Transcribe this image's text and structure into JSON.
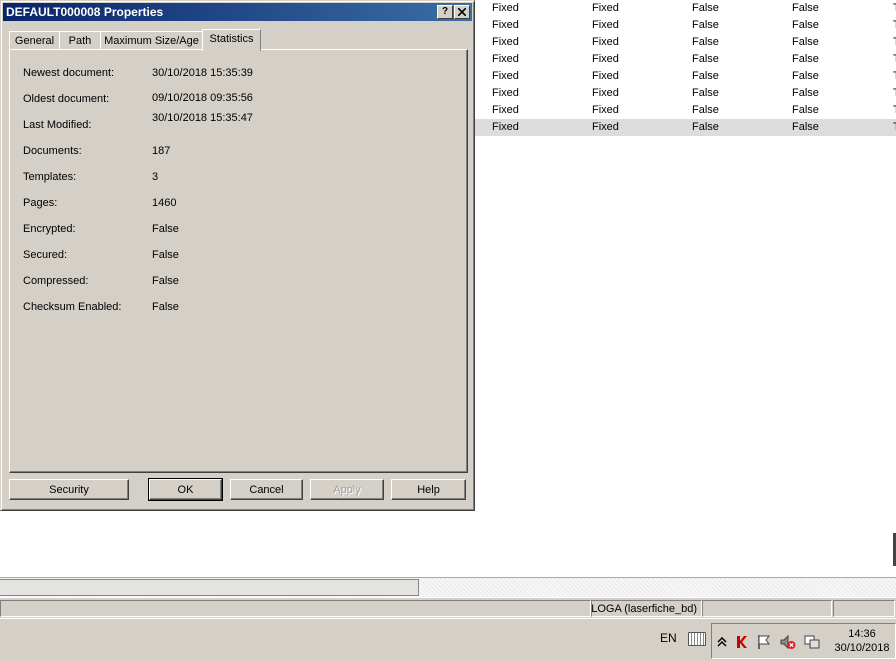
{
  "dialog": {
    "title": "DEFAULT000008 Properties",
    "help_btn": "?",
    "close_btn": "✕",
    "tabs": [
      "General",
      "Path",
      "Maximum Size/Age",
      "Statistics"
    ],
    "active_tab": "Statistics",
    "properties": [
      {
        "label": "Newest document:",
        "value": "30/10/2018 15:35:39"
      },
      {
        "label": "Oldest document:",
        "value": "09/10/2018 09:35:56"
      },
      {
        "label": "Last Modified:",
        "value": "30/10/2018 15:35:47"
      },
      {
        "label": "Documents:",
        "value": "187"
      },
      {
        "label": "Templates:",
        "value": "3"
      },
      {
        "label": "Pages:",
        "value": "1460"
      },
      {
        "label": "Encrypted:",
        "value": "False"
      },
      {
        "label": "Secured:",
        "value": "False"
      },
      {
        "label": "Compressed:",
        "value": "False"
      },
      {
        "label": "Checksum Enabled:",
        "value": "False"
      }
    ],
    "buttons": {
      "security": "Security",
      "ok": "OK",
      "cancel": "Cancel",
      "apply": "Apply",
      "help": "Help"
    }
  },
  "background_list": {
    "rows": [
      [
        "Fixed",
        "Fixed",
        "False",
        "False",
        "T"
      ],
      [
        "Fixed",
        "Fixed",
        "False",
        "False",
        "T"
      ],
      [
        "Fixed",
        "Fixed",
        "False",
        "False",
        "T"
      ],
      [
        "Fixed",
        "Fixed",
        "False",
        "False",
        "T"
      ],
      [
        "Fixed",
        "Fixed",
        "False",
        "False",
        "T"
      ],
      [
        "Fixed",
        "Fixed",
        "False",
        "False",
        "T"
      ],
      [
        "Fixed",
        "Fixed",
        "False",
        "False",
        "T"
      ],
      [
        "Fixed",
        "Fixed",
        "False",
        "False",
        "T"
      ]
    ]
  },
  "statusbar": {
    "server": "LOGA (laserfiche_bd)"
  },
  "taskbar": {
    "language": "EN",
    "time": "14:36",
    "date": "30/10/2018",
    "chevron": "«"
  },
  "colors": {
    "title_start": "#0a246a",
    "title_end": "#3a6ea5",
    "face": "#d4d0c8",
    "selection": "#dcdcdc"
  }
}
